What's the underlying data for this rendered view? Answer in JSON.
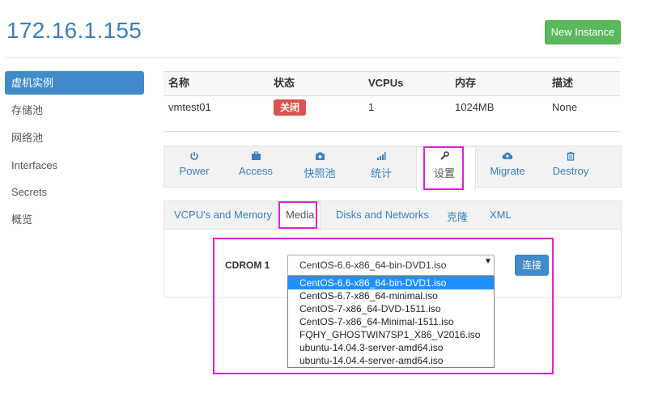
{
  "header": {
    "host": "172.16.1.155",
    "new_instance": "New Instance"
  },
  "sidebar": {
    "items": [
      {
        "label": "虚机实例",
        "active": true
      },
      {
        "label": "存储池"
      },
      {
        "label": "网络池"
      },
      {
        "label": "Interfaces"
      },
      {
        "label": "Secrets"
      },
      {
        "label": "概览"
      }
    ]
  },
  "table": {
    "headers": [
      "名称",
      "状态",
      "VCPUs",
      "内存",
      "描述"
    ],
    "row": {
      "name": "vmtest01",
      "status": "关闭",
      "vcpus": "1",
      "memory": "1024MB",
      "description": "None"
    }
  },
  "actions": [
    {
      "label": "Power",
      "icon": "power-icon"
    },
    {
      "label": "Access",
      "icon": "briefcase-icon"
    },
    {
      "label": "快照池",
      "icon": "camera-icon"
    },
    {
      "label": "统计",
      "icon": "bar-chart-icon"
    },
    {
      "label": "设置",
      "icon": "wrench-icon",
      "active": true
    },
    {
      "label": "Migrate",
      "icon": "cloud-upload-icon"
    },
    {
      "label": "Destroy",
      "icon": "trash-icon"
    }
  ],
  "subtabs": [
    {
      "label": "VCPU's and Memory"
    },
    {
      "label": "Media",
      "active": true
    },
    {
      "label": "Disks and Networks"
    },
    {
      "label": "克隆"
    },
    {
      "label": "XML"
    }
  ],
  "media": {
    "cdrom_label": "CDROM 1",
    "selected": "CentOS-6.6-x86_64-bin-DVD1.iso",
    "options": [
      "CentOS-6.6-x86_64-bin-DVD1.iso",
      "CentOS-6.7-x86_64-minimal.iso",
      "CentOS-7-x86_64-DVD-1511.iso",
      "CentOS-7-x86_64-Minimal-1511.iso",
      "FQHY_GHOSTWIN7SP1_X86_V2016.iso",
      "ubuntu-14.04.3-server-amd64.iso",
      "ubuntu-14.04.4-server-amd64.iso"
    ],
    "connect": "连接"
  },
  "colors": {
    "accent": "#428bca",
    "success": "#5cb85c",
    "danger": "#d9534f",
    "highlight": "#e020d0"
  }
}
